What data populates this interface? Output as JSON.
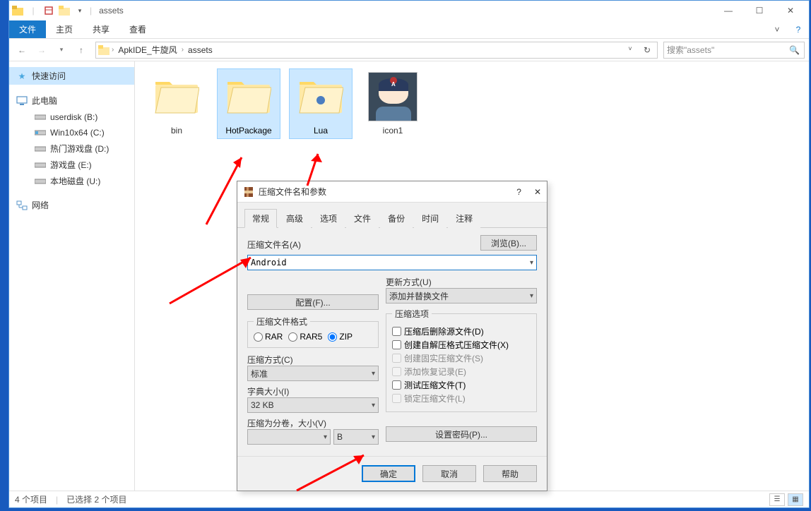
{
  "window": {
    "title": "assets",
    "controls": {
      "min": "—",
      "max": "☐",
      "close": "✕"
    }
  },
  "ribbon": {
    "file": "文件",
    "tabs": [
      "主页",
      "共享",
      "查看"
    ]
  },
  "breadcrumb": {
    "parts": [
      "ApkIDE_牛旋风",
      "assets"
    ]
  },
  "search": {
    "placeholder": "搜索\"assets\""
  },
  "sidebar": {
    "quick_access": "快速访问",
    "this_pc": "此电脑",
    "drives": [
      "userdisk (B:)",
      "Win10x64 (C:)",
      "热门游戏盘 (D:)",
      "游戏盘 (E:)",
      "本地磁盘 (U:)"
    ],
    "network": "网络"
  },
  "files": [
    {
      "name": "bin",
      "type": "folder",
      "selected": false
    },
    {
      "name": "HotPackage",
      "type": "folder",
      "selected": true
    },
    {
      "name": "Lua",
      "type": "folder_lua",
      "selected": true
    },
    {
      "name": "icon1",
      "type": "icon",
      "selected": false
    }
  ],
  "status": {
    "count": "4 个项目",
    "selected": "已选择 2 个项目"
  },
  "dialog": {
    "title": "压缩文件名和参数",
    "help": "?",
    "close": "✕",
    "tabs": [
      "常规",
      "高级",
      "选项",
      "文件",
      "备份",
      "时间",
      "注释"
    ],
    "active_tab": 0,
    "archive_name_label": "压缩文件名(A)",
    "archive_name_value": "Android",
    "browse": "浏览(B)...",
    "update_label": "更新方式(U)",
    "update_value": "添加并替换文件",
    "config_btn": "配置(F)...",
    "format_legend": "压缩文件格式",
    "format_opts": [
      "RAR",
      "RAR5",
      "ZIP"
    ],
    "format_selected": 2,
    "method_label": "压缩方式(C)",
    "method_value": "标准",
    "dict_label": "字典大小(I)",
    "dict_value": "32 KB",
    "split_label": "压缩为分卷，大小(V)",
    "split_value": "",
    "split_unit": "B",
    "options_legend": "压缩选项",
    "options": [
      {
        "label": "压缩后删除源文件(D)",
        "enabled": true,
        "checked": false
      },
      {
        "label": "创建自解压格式压缩文件(X)",
        "enabled": true,
        "checked": false
      },
      {
        "label": "创建固实压缩文件(S)",
        "enabled": false,
        "checked": false
      },
      {
        "label": "添加恢复记录(E)",
        "enabled": false,
        "checked": false
      },
      {
        "label": "测试压缩文件(T)",
        "enabled": true,
        "checked": false
      },
      {
        "label": "锁定压缩文件(L)",
        "enabled": false,
        "checked": false
      }
    ],
    "password_btn": "设置密码(P)...",
    "ok": "确定",
    "cancel": "取消",
    "help_btn": "帮助"
  }
}
